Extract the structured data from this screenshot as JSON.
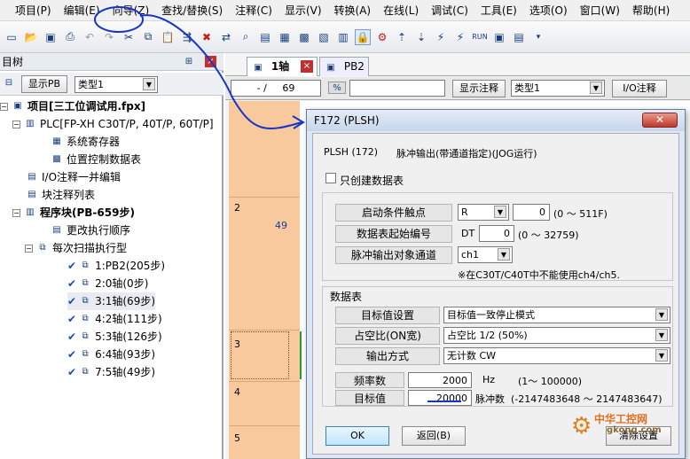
{
  "menu": [
    "项目(P)",
    "编辑(E)",
    "向导(Z)",
    "查找/替换(S)",
    "注释(C)",
    "显示(V)",
    "转换(A)",
    "在线(L)",
    "调试(C)",
    "工具(E)",
    "选项(O)",
    "窗口(W)",
    "帮助(H)"
  ],
  "left_panel": {
    "title": "目树",
    "show_pb": "显示PB",
    "type_select": "类型1",
    "tree": {
      "project": "项目[三工位调试用.fpx]",
      "plc": "PLC[FP-XH C30T/P, 40T/P, 60T/P]",
      "sys_reg": "系统寄存器",
      "pos_ctrl": "位置控制数据表",
      "io_comment": "I/O注释一并编辑",
      "block_comment": "块注释列表",
      "program": "程序块(PB-659步)",
      "change_order": "更改执行顺序",
      "scan": "每次扫描执行型",
      "items": [
        "1:PB2(205步)",
        "2:0轴(0步)",
        "3:1轴(69步)",
        "4:2轴(111步)",
        "5:3轴(126步)",
        "6:4轴(93步)",
        "7:5轴(49步)"
      ]
    }
  },
  "editor": {
    "tab1": "1轴",
    "tab2": "PB2",
    "pos_left": "- /",
    "pos_val": "69",
    "show_comment": "显示注释",
    "type_select": "类型1",
    "io_comment": "I/O注释",
    "row_numbers": [
      "2",
      "3",
      "4",
      "5"
    ],
    "step_49": "49"
  },
  "dialog": {
    "title": "F172 (PLSH)",
    "heading_code": "PLSH (172)",
    "heading_desc": "脉冲输出(带通道指定)(JOG运行)",
    "only_create_table": "只创建数据表",
    "start_contact_label": "启动条件触点",
    "start_contact_select": "R",
    "start_contact_value": "0",
    "start_contact_range": "(0 ～ 511F)",
    "table_start_label": "数据表起始编号",
    "table_start_prefix": "DT",
    "table_start_value": "0",
    "table_start_range": "(0 ～ 32759)",
    "channel_label": "脉冲输出对象通道",
    "channel_select": "ch1",
    "channel_note": "※在C30T/C40T中不能使用ch4/ch5.",
    "table_group": "数据表",
    "target_setting_label": "目标值设置",
    "target_setting_select": "目标值一致停止模式",
    "duty_label": "占空比(ON宽)",
    "duty_select": "占空比 1/2 (50%)",
    "output_mode_label": "输出方式",
    "output_mode_select": "无计数 CW",
    "freq_label": "频率数",
    "freq_value": "2000",
    "freq_unit": "Hz",
    "freq_range": "(1～ 100000)",
    "target_label": "目标值",
    "target_value": "20000",
    "target_unit": "脉冲数",
    "target_range": "(-2147483648 ～ 2147483647)",
    "ok": "OK",
    "back": "返回(B)",
    "clear": "清除设置"
  },
  "watermark": {
    "line1": "中华工控网",
    "line2": "gkong.com"
  },
  "colors": {
    "ladder_bg": "#f9c99e",
    "annotation": "#1535c8",
    "dialog_frame": "#dce6f4"
  }
}
